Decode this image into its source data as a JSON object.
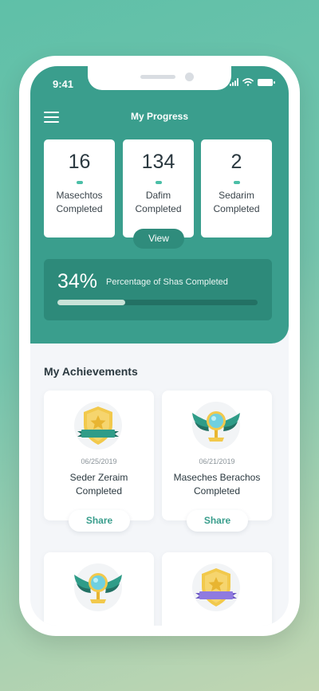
{
  "status_bar": {
    "time": "9:41"
  },
  "header": {
    "title": "My Progress"
  },
  "stats": [
    {
      "value": "16",
      "label_line1": "Masechtos",
      "label_line2": "Completed"
    },
    {
      "value": "134",
      "label_line1": "Dafim",
      "label_line2": "Completed"
    },
    {
      "value": "2",
      "label_line1": "Sedarim",
      "label_line2": "Completed"
    }
  ],
  "view_button": {
    "label": "View"
  },
  "shas": {
    "percent_label": "34%",
    "label": "Percentage of Shas Completed",
    "progress_fraction": 0.34
  },
  "achievements": {
    "title": "My Achievements",
    "items": [
      {
        "date": "06/25/2019",
        "title_line1": "Seder Zeraim",
        "title_line2": "Completed",
        "share": "Share",
        "icon": "star-shield-badge-icon"
      },
      {
        "date": "06/21/2019",
        "title_line1": "Maseches Berachos",
        "title_line2": "Completed",
        "share": "Share",
        "icon": "winged-trophy-icon"
      },
      {
        "icon": "winged-trophy-icon"
      },
      {
        "icon": "star-shield-badge-icon"
      }
    ]
  },
  "colors": {
    "header": "#3a9e8d",
    "accent": "#4bbfa7",
    "panel": "#2d8a7a",
    "badge_gold": "#f2c94c",
    "ribbon_teal": "#2f8c7c",
    "ribbon_purple": "#8f7ae0"
  }
}
